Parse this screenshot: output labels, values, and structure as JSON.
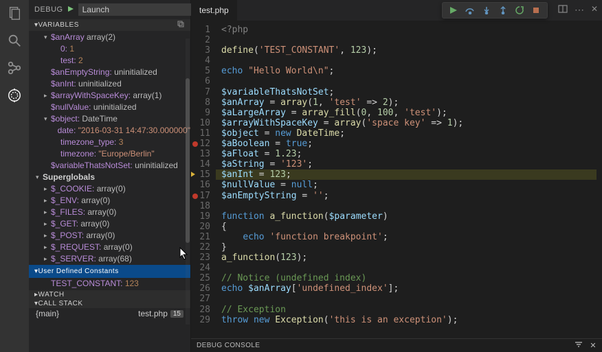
{
  "activity": {
    "items": [
      "explorer",
      "search",
      "scm",
      "debug"
    ]
  },
  "sidebar": {
    "title": "DEBUG",
    "config": "Launch",
    "sections": {
      "variables": "VARIABLES",
      "watch": "WATCH",
      "callstack": "CALL STACK",
      "udc": "User Defined Constants",
      "supers": "Superglobals"
    },
    "vars": {
      "anArray": {
        "name": "$anArray",
        "type": "array(2)",
        "k0": "0:",
        "v0": "1",
        "k1": "test:",
        "v1": "2"
      },
      "anEmptyString": {
        "name": "$anEmptyString:",
        "val": "uninitialized"
      },
      "anInt": {
        "name": "$anInt:",
        "val": "uninitialized"
      },
      "arrayWithSpaceKey": {
        "name": "$arrayWithSpaceKey:",
        "val": "array(1)"
      },
      "nullValue": {
        "name": "$nullValue:",
        "val": "uninitialized"
      },
      "object": {
        "name": "$object:",
        "val": "DateTime",
        "date_k": "date:",
        "date_v": "\"2016-03-31 14:47:30.000000\"",
        "tz_k": "timezone_type:",
        "tz_v": "3",
        "tzn_k": "timezone:",
        "tzn_v": "\"Europe/Berlin\""
      },
      "varNotSet": {
        "name": "$variableThatsNotSet:",
        "val": "uninitialized"
      }
    },
    "superglobals": [
      {
        "k": "$_COOKIE:",
        "v": "array(0)"
      },
      {
        "k": "$_ENV:",
        "v": "array(0)"
      },
      {
        "k": "$_FILES:",
        "v": "array(0)"
      },
      {
        "k": "$_GET:",
        "v": "array(0)"
      },
      {
        "k": "$_POST:",
        "v": "array(0)"
      },
      {
        "k": "$_REQUEST:",
        "v": "array(0)"
      },
      {
        "k": "$_SERVER:",
        "v": "array(68)"
      }
    ],
    "udc": {
      "k": "TEST_CONSTANT:",
      "v": "123"
    },
    "callstack": {
      "frame": "{main}",
      "file": "test.php",
      "line": "15"
    }
  },
  "editor": {
    "tab": "test.php",
    "debug_console": "DEBUG CONSOLE"
  },
  "code": [
    {
      "n": 1,
      "tokens": [
        [
          "k-php",
          "<?php"
        ]
      ]
    },
    {
      "n": 2,
      "tokens": []
    },
    {
      "n": 3,
      "tokens": [
        [
          "k-fn",
          "define"
        ],
        [
          "k-op",
          "("
        ],
        [
          "k-str",
          "'TEST_CONSTANT'"
        ],
        [
          "k-op",
          ", "
        ],
        [
          "k-num",
          "123"
        ],
        [
          "k-op",
          ");"
        ]
      ]
    },
    {
      "n": 4,
      "tokens": []
    },
    {
      "n": 5,
      "tokens": [
        [
          "k-kw",
          "echo "
        ],
        [
          "k-str",
          "\"Hello World\\n\""
        ],
        [
          "k-op",
          ";"
        ]
      ]
    },
    {
      "n": 6,
      "tokens": []
    },
    {
      "n": 7,
      "tokens": [
        [
          "k-var",
          "$variableThatsNotSet"
        ],
        [
          "k-op",
          ";"
        ]
      ]
    },
    {
      "n": 8,
      "tokens": [
        [
          "k-var",
          "$anArray"
        ],
        [
          "k-op",
          " = "
        ],
        [
          "k-fn",
          "array"
        ],
        [
          "k-op",
          "("
        ],
        [
          "k-num",
          "1"
        ],
        [
          "k-op",
          ", "
        ],
        [
          "k-str",
          "'test'"
        ],
        [
          "k-op",
          " => "
        ],
        [
          "k-num",
          "2"
        ],
        [
          "k-op",
          ");"
        ]
      ]
    },
    {
      "n": 9,
      "tokens": [
        [
          "k-var",
          "$aLargeArray"
        ],
        [
          "k-op",
          " = "
        ],
        [
          "k-fn",
          "array_fill"
        ],
        [
          "k-op",
          "("
        ],
        [
          "k-num",
          "0"
        ],
        [
          "k-op",
          ", "
        ],
        [
          "k-num",
          "100"
        ],
        [
          "k-op",
          ", "
        ],
        [
          "k-str",
          "'test'"
        ],
        [
          "k-op",
          ");"
        ]
      ]
    },
    {
      "n": 10,
      "tokens": [
        [
          "k-var",
          "$arrayWithSpaceKey"
        ],
        [
          "k-op",
          " = "
        ],
        [
          "k-fn",
          "array"
        ],
        [
          "k-op",
          "("
        ],
        [
          "k-str",
          "'space key'"
        ],
        [
          "k-op",
          " => "
        ],
        [
          "k-num",
          "1"
        ],
        [
          "k-op",
          ");"
        ]
      ]
    },
    {
      "n": 11,
      "tokens": [
        [
          "k-var",
          "$object"
        ],
        [
          "k-op",
          " = "
        ],
        [
          "k-kw",
          "new "
        ],
        [
          "k-fn",
          "DateTime"
        ],
        [
          "k-op",
          ";"
        ]
      ]
    },
    {
      "n": 12,
      "tokens": [
        [
          "k-var",
          "$aBoolean"
        ],
        [
          "k-op",
          " = "
        ],
        [
          "k-kw",
          "true"
        ],
        [
          "k-op",
          ";"
        ]
      ],
      "bp": true
    },
    {
      "n": 13,
      "tokens": [
        [
          "k-var",
          "$aFloat"
        ],
        [
          "k-op",
          " = "
        ],
        [
          "k-num",
          "1.23"
        ],
        [
          "k-op",
          ";"
        ]
      ]
    },
    {
      "n": 14,
      "tokens": [
        [
          "k-var",
          "$aString"
        ],
        [
          "k-op",
          " = "
        ],
        [
          "k-str",
          "'123'"
        ],
        [
          "k-op",
          ";"
        ]
      ]
    },
    {
      "n": 15,
      "tokens": [
        [
          "k-var",
          "$anInt"
        ],
        [
          "k-op",
          " = "
        ],
        [
          "k-num",
          "123"
        ],
        [
          "k-op",
          ";"
        ]
      ],
      "current": true
    },
    {
      "n": 16,
      "tokens": [
        [
          "k-var",
          "$nullValue"
        ],
        [
          "k-op",
          " = "
        ],
        [
          "k-kw",
          "null"
        ],
        [
          "k-op",
          ";"
        ]
      ]
    },
    {
      "n": 17,
      "tokens": [
        [
          "k-var",
          "$anEmptyString"
        ],
        [
          "k-op",
          " = "
        ],
        [
          "k-str",
          "''"
        ],
        [
          "k-op",
          ";"
        ]
      ],
      "bp": true
    },
    {
      "n": 18,
      "tokens": []
    },
    {
      "n": 19,
      "tokens": [
        [
          "k-kw",
          "function "
        ],
        [
          "k-fn",
          "a_function"
        ],
        [
          "k-op",
          "("
        ],
        [
          "k-var",
          "$parameter"
        ],
        [
          "k-op",
          ")"
        ]
      ]
    },
    {
      "n": 20,
      "tokens": [
        [
          "k-op",
          "{"
        ]
      ]
    },
    {
      "n": 21,
      "tokens": [
        [
          "k-op",
          "    "
        ],
        [
          "k-kw",
          "echo "
        ],
        [
          "k-str",
          "'function breakpoint'"
        ],
        [
          "k-op",
          ";"
        ]
      ]
    },
    {
      "n": 22,
      "tokens": [
        [
          "k-op",
          "}"
        ]
      ]
    },
    {
      "n": 23,
      "tokens": [
        [
          "k-fn",
          "a_function"
        ],
        [
          "k-op",
          "("
        ],
        [
          "k-num",
          "123"
        ],
        [
          "k-op",
          ");"
        ]
      ]
    },
    {
      "n": 24,
      "tokens": []
    },
    {
      "n": 25,
      "tokens": [
        [
          "k-cm",
          "// Notice (undefined index)"
        ]
      ]
    },
    {
      "n": 26,
      "tokens": [
        [
          "k-kw",
          "echo "
        ],
        [
          "k-var",
          "$anArray"
        ],
        [
          "k-op",
          "["
        ],
        [
          "k-str",
          "'undefined_index'"
        ],
        [
          "k-op",
          "];"
        ]
      ]
    },
    {
      "n": 27,
      "tokens": []
    },
    {
      "n": 28,
      "tokens": [
        [
          "k-cm",
          "// Exception"
        ]
      ]
    },
    {
      "n": 29,
      "tokens": [
        [
          "k-kw",
          "throw new "
        ],
        [
          "k-fn",
          "Exception"
        ],
        [
          "k-op",
          "("
        ],
        [
          "k-str",
          "'this is an exception'"
        ],
        [
          "k-op",
          ");"
        ]
      ]
    }
  ]
}
